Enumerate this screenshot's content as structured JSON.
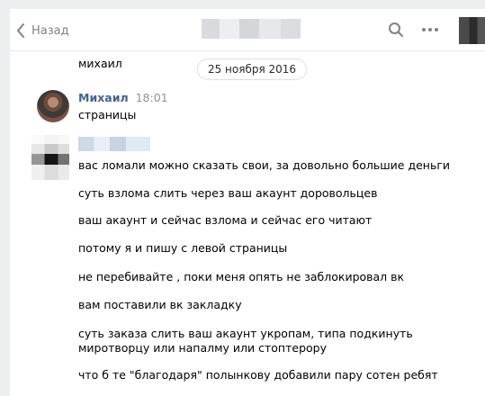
{
  "header": {
    "back_label": "Назад",
    "icons": [
      "chevron-left-icon",
      "search-icon",
      "more-icon"
    ]
  },
  "chat": {
    "previous_text": "михаил",
    "date_badge": "25 ноября 2016",
    "message1": {
      "author": "Михаил",
      "time": "18:01",
      "text": "страницы"
    },
    "messages": [
      "вас ломали можно сказать свои, за довольно большие деньги",
      "суть взлома слить через ваш акаунт доровольцев",
      "ваш акаунт и сейчас взлома и сейчас его читают",
      "потому я и пишу с левой страницы",
      "не перебивайте , поки меня опять не заблокировал вк",
      "вам поставили вк закладку",
      "суть заказа слить ваш акаунт укропам, типа подкинуть\nмиротворцу или напалму или стоптерору",
      "что б те \"благодаря\" полынкову добавили пару сотен ребят"
    ]
  },
  "colors": {
    "background": "#edeef0",
    "author": "#42648b",
    "muted": "#828282"
  }
}
